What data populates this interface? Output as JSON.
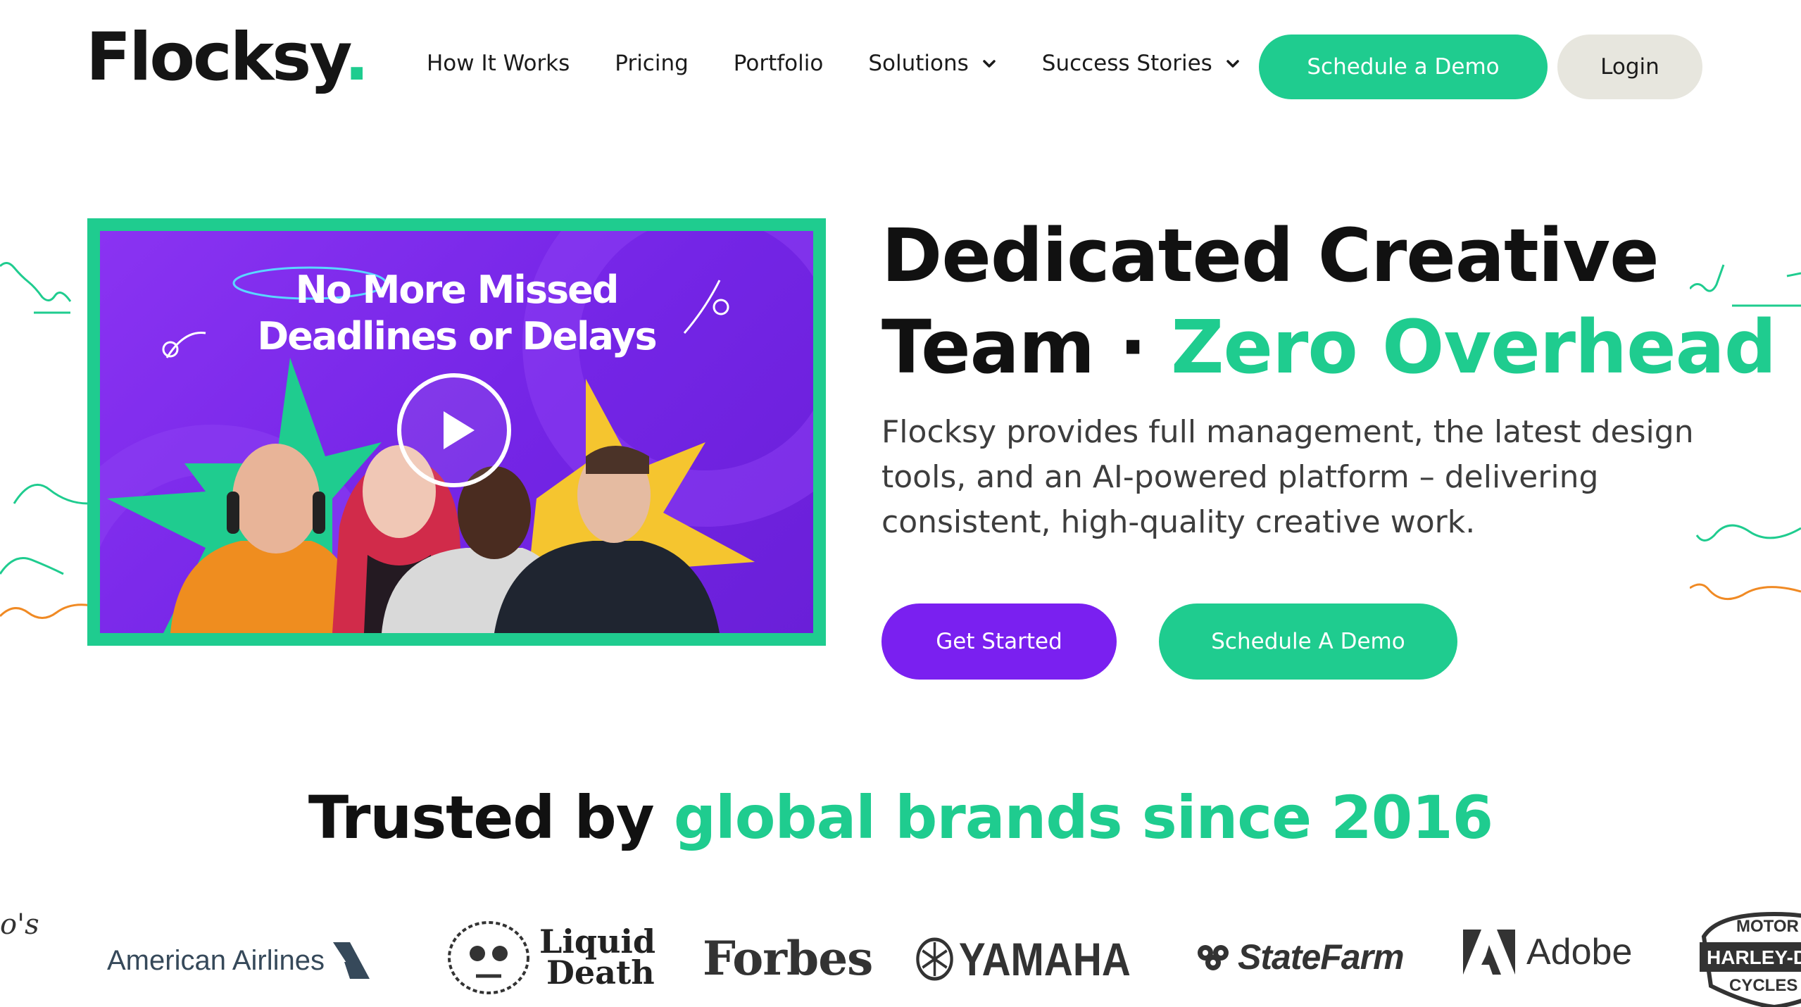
{
  "header": {
    "logo_text": "Flocksy",
    "logo_dot": ".",
    "nav": [
      {
        "label": "How It Works"
      },
      {
        "label": "Pricing"
      },
      {
        "label": "Portfolio"
      },
      {
        "label": "Solutions",
        "has_dropdown": true
      },
      {
        "label": "Success Stories",
        "has_dropdown": true
      }
    ],
    "schedule_demo_label": "Schedule a Demo",
    "login_label": "Login"
  },
  "video": {
    "title_line1": "No More Missed",
    "title_line2": "Deadlines or Delays",
    "play_icon": "play-icon"
  },
  "hero": {
    "title_line1": "Dedicated Creative",
    "title_line2_plain": "Team · ",
    "title_line2_accent": "Zero Overhead",
    "description": "Flocksy provides full management, the latest design tools, and an AI-powered platform – delivering consistent, high-quality creative work.",
    "get_started_label": "Get Started",
    "schedule_demo_label": "Schedule A Demo"
  },
  "trusted": {
    "plain": "Trusted by ",
    "accent": "global brands since 2016"
  },
  "brands": {
    "partial_left": "o's",
    "american_airlines": "American Airlines",
    "liquid_death_1": "Liquid",
    "liquid_death_2": "Death",
    "forbes": "Forbes",
    "yamaha": "YAMAHA",
    "state_farm": "StateFarm",
    "adobe": "Adobe",
    "harley_1": "MOTOR",
    "harley_2": "HARLEY-DAVI",
    "harley_3": "CYCLES"
  },
  "colors": {
    "brand_green": "#1fcc8f",
    "brand_purple": "#7a20f0",
    "login_bg": "#e7e6de",
    "text_dark": "#111111"
  }
}
